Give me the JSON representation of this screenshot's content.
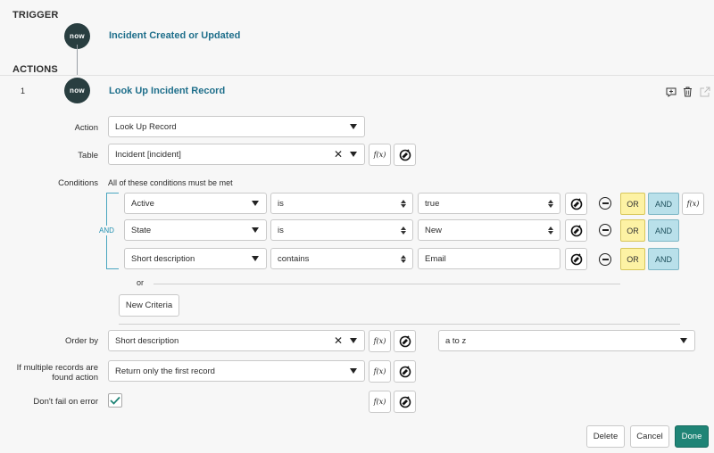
{
  "trigger": {
    "section_label": "TRIGGER",
    "badge_text": "now",
    "title": "Incident Created or Updated"
  },
  "actions": {
    "section_label": "ACTIONS"
  },
  "step": {
    "number": "1",
    "badge_text": "now",
    "title": "Look Up Incident Record",
    "tools": [
      "add-comment-icon",
      "trash-icon",
      "open-external-icon"
    ]
  },
  "form": {
    "action": {
      "label": "Action",
      "value": "Look Up Record"
    },
    "table": {
      "label": "Table",
      "value": "Incident [incident]"
    },
    "conditions": {
      "label": "Conditions",
      "summary": "All of these conditions must be met",
      "join_label": "AND",
      "rows": [
        {
          "field": "Active",
          "operator": "is",
          "value": "true"
        },
        {
          "field": "State",
          "operator": "is",
          "value": "New"
        },
        {
          "field": "Short description",
          "operator": "contains",
          "value": "Email"
        }
      ],
      "or_label": "OR",
      "and_label": "AND",
      "or_divider": "or",
      "new_criteria": "New Criteria"
    },
    "order_by": {
      "label": "Order by",
      "value": "Short description",
      "direction": "a to z"
    },
    "multiple": {
      "label": "If multiple records are found action",
      "value": "Return only the first record"
    },
    "dont_fail": {
      "label": "Don't fail on error",
      "checked": true
    },
    "fx_label": "f(x)"
  },
  "footer": {
    "delete": "Delete",
    "cancel": "Cancel",
    "done": "Done"
  },
  "colors": {
    "accent": "#1f6f8b",
    "done": "#1f8476",
    "or_bg": "#fdf2a4",
    "and_bg": "#b9e0ea"
  }
}
